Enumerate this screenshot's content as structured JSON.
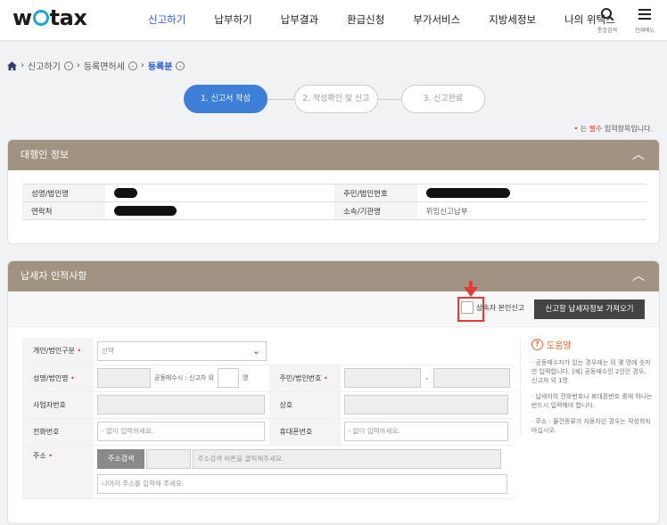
{
  "header": {
    "logo": {
      "pre": "w",
      "post": "tax"
    },
    "nav": [
      "신고하기",
      "납부하기",
      "납부결과",
      "환급신청",
      "부가서비스",
      "지방세정보",
      "나의 위택스"
    ],
    "search_caption": "통합검색",
    "menu_caption": "전체메뉴",
    "colors": {
      "active": "#2a5bd7",
      "logo_accent": "#1aa7d8"
    }
  },
  "breadcrumb": {
    "home_icon": "home-icon",
    "items": [
      "신고하기",
      "등록면허세",
      "등록분"
    ]
  },
  "steps": [
    "1. 신고서 작성",
    "2. 작성확인 및 신고",
    "3. 신고완료"
  ],
  "required_note": {
    "mark": "•",
    "pre": " 는 ",
    "word": "필수",
    "post": " 입력항목입니다."
  },
  "agent_section": {
    "title": "대행인 정보",
    "fields": {
      "name": "성명/법인명",
      "resident_no": "주민/법인번호",
      "contact": "연락처",
      "affiliation": "소속/기관명",
      "affiliation_value": "위임신고납부"
    }
  },
  "taxpayer_section": {
    "title": "납세자 인적사항",
    "self_report_label": "상속자 본인신고",
    "load_button": "신고할 납세자정보 가져오기",
    "rows": {
      "type_label": "개인/법인구분",
      "type_value": "선택",
      "name_label": "성명/법인명",
      "co_owner_text": "공동매수시 : 신고자 외",
      "co_owner_unit": "명",
      "resident_label": "주민/법인번호",
      "resident_dash": "-",
      "biz_label": "사업자번호",
      "trade_label": "상호",
      "phone_label": "전화번호",
      "phone_placeholder": "- 없이 입력하세요.",
      "mobile_label": "휴대폰번호",
      "mobile_placeholder": "- 없이 입력하세요.",
      "address_label": "주소",
      "address_button": "주소검색",
      "address_hint": "주소검색 버튼을 클릭해주세요.",
      "address_detail_placeholder": "나머지 주소를 입력해 주세요."
    },
    "help": {
      "title": "도움말",
      "items": [
        "· 공동매수자가 있는 경우에는 외 몇 명에 숫자만 입력합니다. [예] 공동매수인 2인인 경우, 신고자 외 1명",
        "· 납세자의 전화번호나 휴대폰번호 중에 하나는 반드시 입력해야 합니다.",
        "· 주소 : 물건종류가 자동차인 경우는 작성하지 마십시오."
      ]
    }
  }
}
